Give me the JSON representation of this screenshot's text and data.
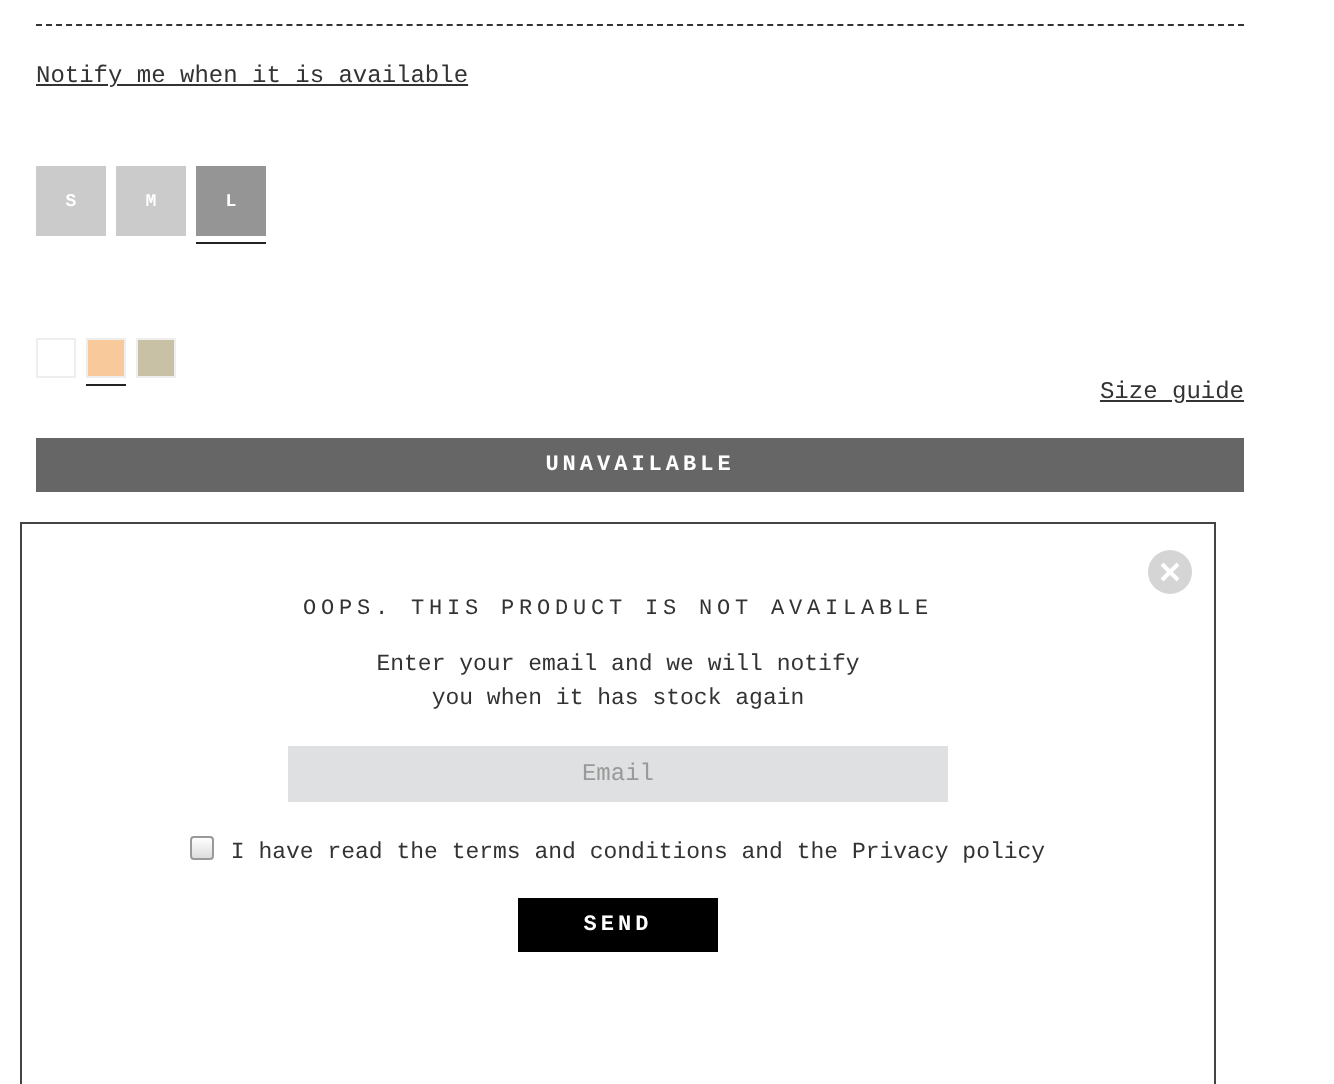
{
  "notify_link": "Notify me when it is available",
  "sizes": [
    {
      "label": "S",
      "selected": false
    },
    {
      "label": "M",
      "selected": false
    },
    {
      "label": "L",
      "selected": true
    }
  ],
  "colors": [
    {
      "color": "#ffffff",
      "selected": false
    },
    {
      "color": "#f7c99b",
      "selected": true
    },
    {
      "color": "#c9c1a5",
      "selected": false
    }
  ],
  "size_guide": "Size guide",
  "unavailable_button": "UNAVAILABLE",
  "modal": {
    "title": "OOPS. THIS PRODUCT IS NOT AVAILABLE",
    "message_lines": [
      "Enter your email and we will notify",
      "you when it has stock again"
    ],
    "email": {
      "placeholder": "Email"
    },
    "terms": {
      "label": "I have read the terms and conditions and the Privacy policy",
      "checked": false
    },
    "send_button": "SEND"
  }
}
